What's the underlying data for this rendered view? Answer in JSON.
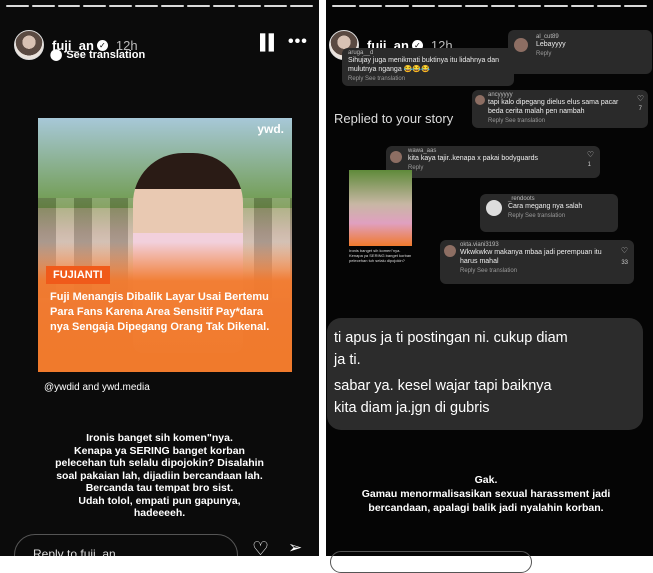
{
  "left": {
    "username": "fuji_an",
    "time": "12h",
    "see_translation": "See translation",
    "card": {
      "brand": "ywd.",
      "tag": "FUJIANTI",
      "headline": "Fuji Menangis Dibalik Layar Usai Bertemu Para Fans Karena Area Sensitif Pay*dara nya Sengaja Dipegang Orang Tak Dikenal."
    },
    "credit": "@ywdid and ywd.media",
    "caption": [
      "Ironis banget sih komen\"nya.",
      "Kenapa ya SERING banget korban",
      "pelecehan tuh selalu dipojokin? Disalahin",
      "soal pakaian lah, dijadiin bercandaan lah.",
      "Bercanda tau tempat bro sist.",
      "Udah tolol, empati pun gapunya,",
      "hadeeeeh."
    ],
    "reply_placeholder": "Reply to fuji_an"
  },
  "right": {
    "username": "fuji_an",
    "time": "12h",
    "replied_label": "Replied to your story",
    "comments": [
      {
        "user": "aruga__d",
        "text": "Sihujay juga menikmati buktinya itu lidahnya dan mulutnya nganga 😂😂😂",
        "actions": "Reply    See translation"
      },
      {
        "user": "al_cut89",
        "text": "Lebayyyy",
        "actions": "Reply"
      },
      {
        "user": "ancyyyyy",
        "text": "tapi kalo dipegang dielus elus sama pacar beda cerita malah pen nambah",
        "actions": "Reply    See translation",
        "likes": "7"
      },
      {
        "user": "wawa_aas",
        "text": "kita kaya tajir..kenapa x pakai bodyguards",
        "actions": "Reply",
        "likes": "1"
      },
      {
        "user": "_rendoots",
        "text": "Cara megang nya salah",
        "actions": "Reply    See translation"
      },
      {
        "user": "okta.viani3193",
        "text": "Wkwkwkw makanya mbaa jadi perempuan itu harus mahal",
        "actions": "Reply    See translation",
        "likes": "33"
      }
    ],
    "thumb_caption": "Ironis banget sih komen\"nya. Kenapa ya SERING banget korban pelecehan tuh selalu dipojokin?",
    "bubble": [
      "ti apus ja ti postingan ni. cukup diam",
      "ja ti.",
      "sabar ya. kesel wajar tapi baiknya",
      "kita diam ja.jgn di gubris"
    ],
    "caption": [
      "Gak.",
      "Gamau menormalisasikan sexual harassment jadi",
      "bercandaan, apalagi balik jadi nyalahin korban."
    ]
  }
}
